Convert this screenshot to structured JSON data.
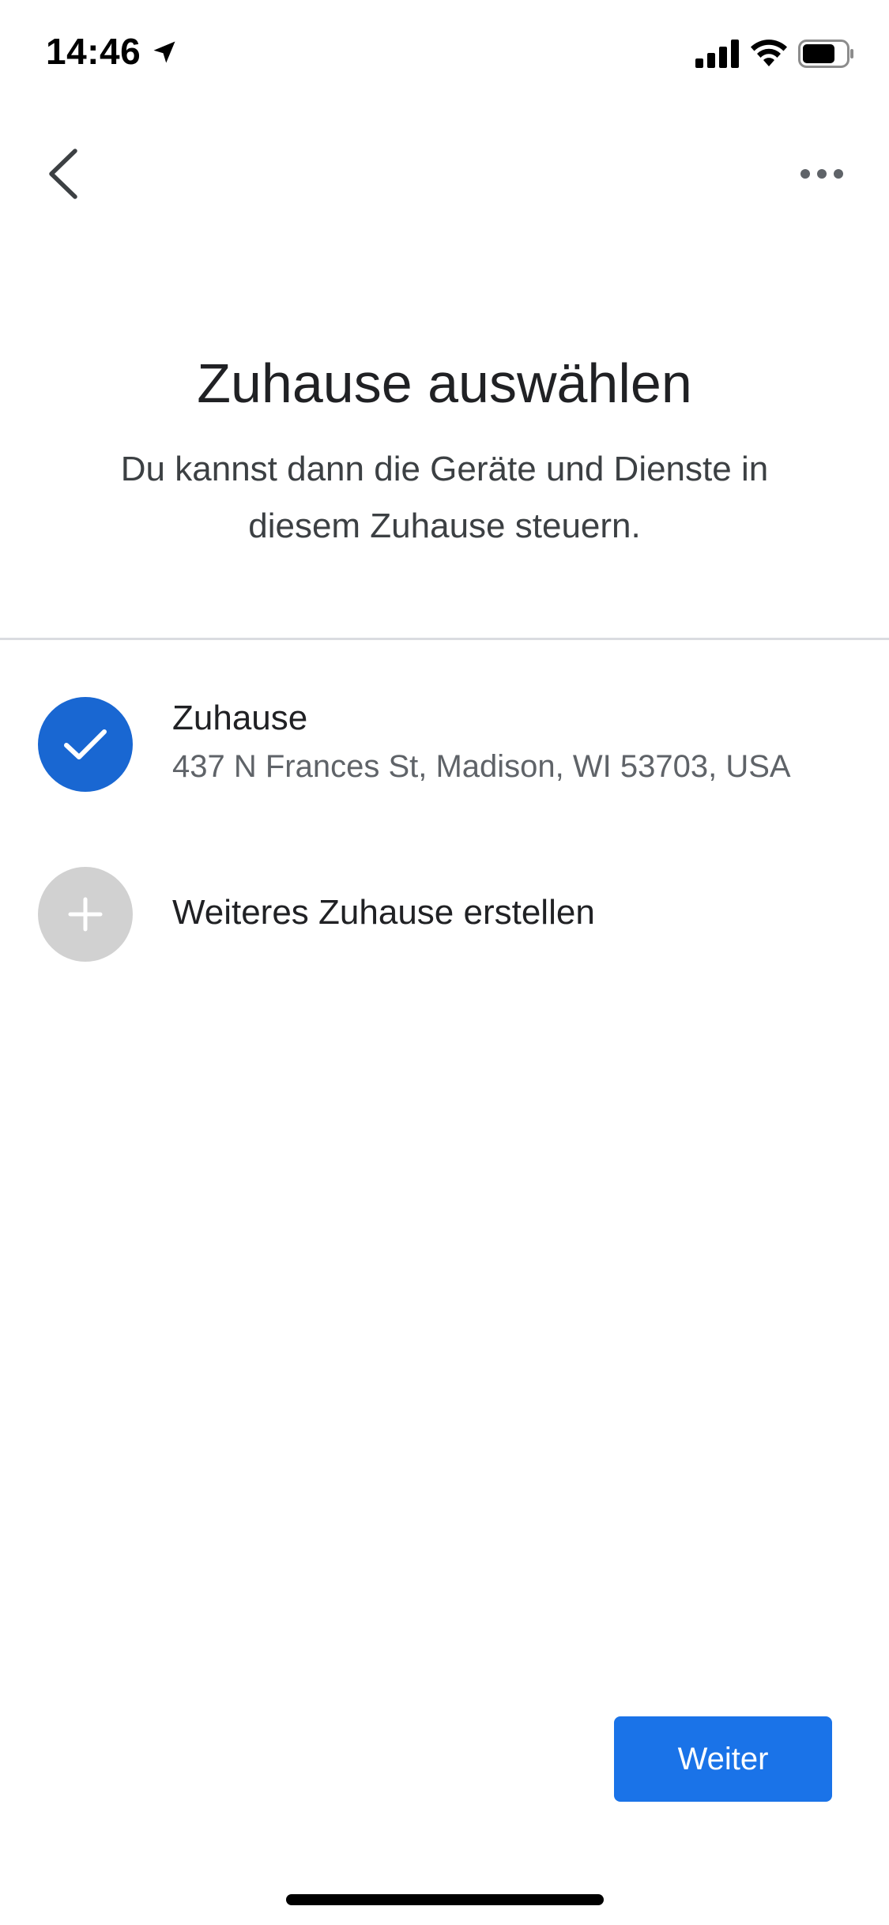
{
  "status_bar": {
    "time": "14:46",
    "icons": [
      "location-arrow-icon",
      "cellular-signal-icon",
      "wifi-icon",
      "battery-icon"
    ]
  },
  "nav": {
    "back_icon": "chevron-left-icon",
    "more_icon": "more-horizontal-icon"
  },
  "header": {
    "title": "Zuhause auswählen",
    "subtitle": "Du kannst dann die Geräte und Dienste in diesem Zuhause steuern."
  },
  "homes": [
    {
      "name": "Zuhause",
      "address": "437 N Frances St, Madison, WI 53703, USA",
      "selected": true,
      "icon": "checkmark-icon"
    }
  ],
  "create_home": {
    "label": "Weiteres Zuhause erstellen",
    "icon": "plus-icon"
  },
  "footer": {
    "continue_label": "Weiter"
  },
  "colors": {
    "accent": "#1a73e8",
    "selected_circle": "#1967d2",
    "add_circle": "#d1d1d1",
    "divider": "#dadce0",
    "secondary_text": "#5f6368"
  }
}
